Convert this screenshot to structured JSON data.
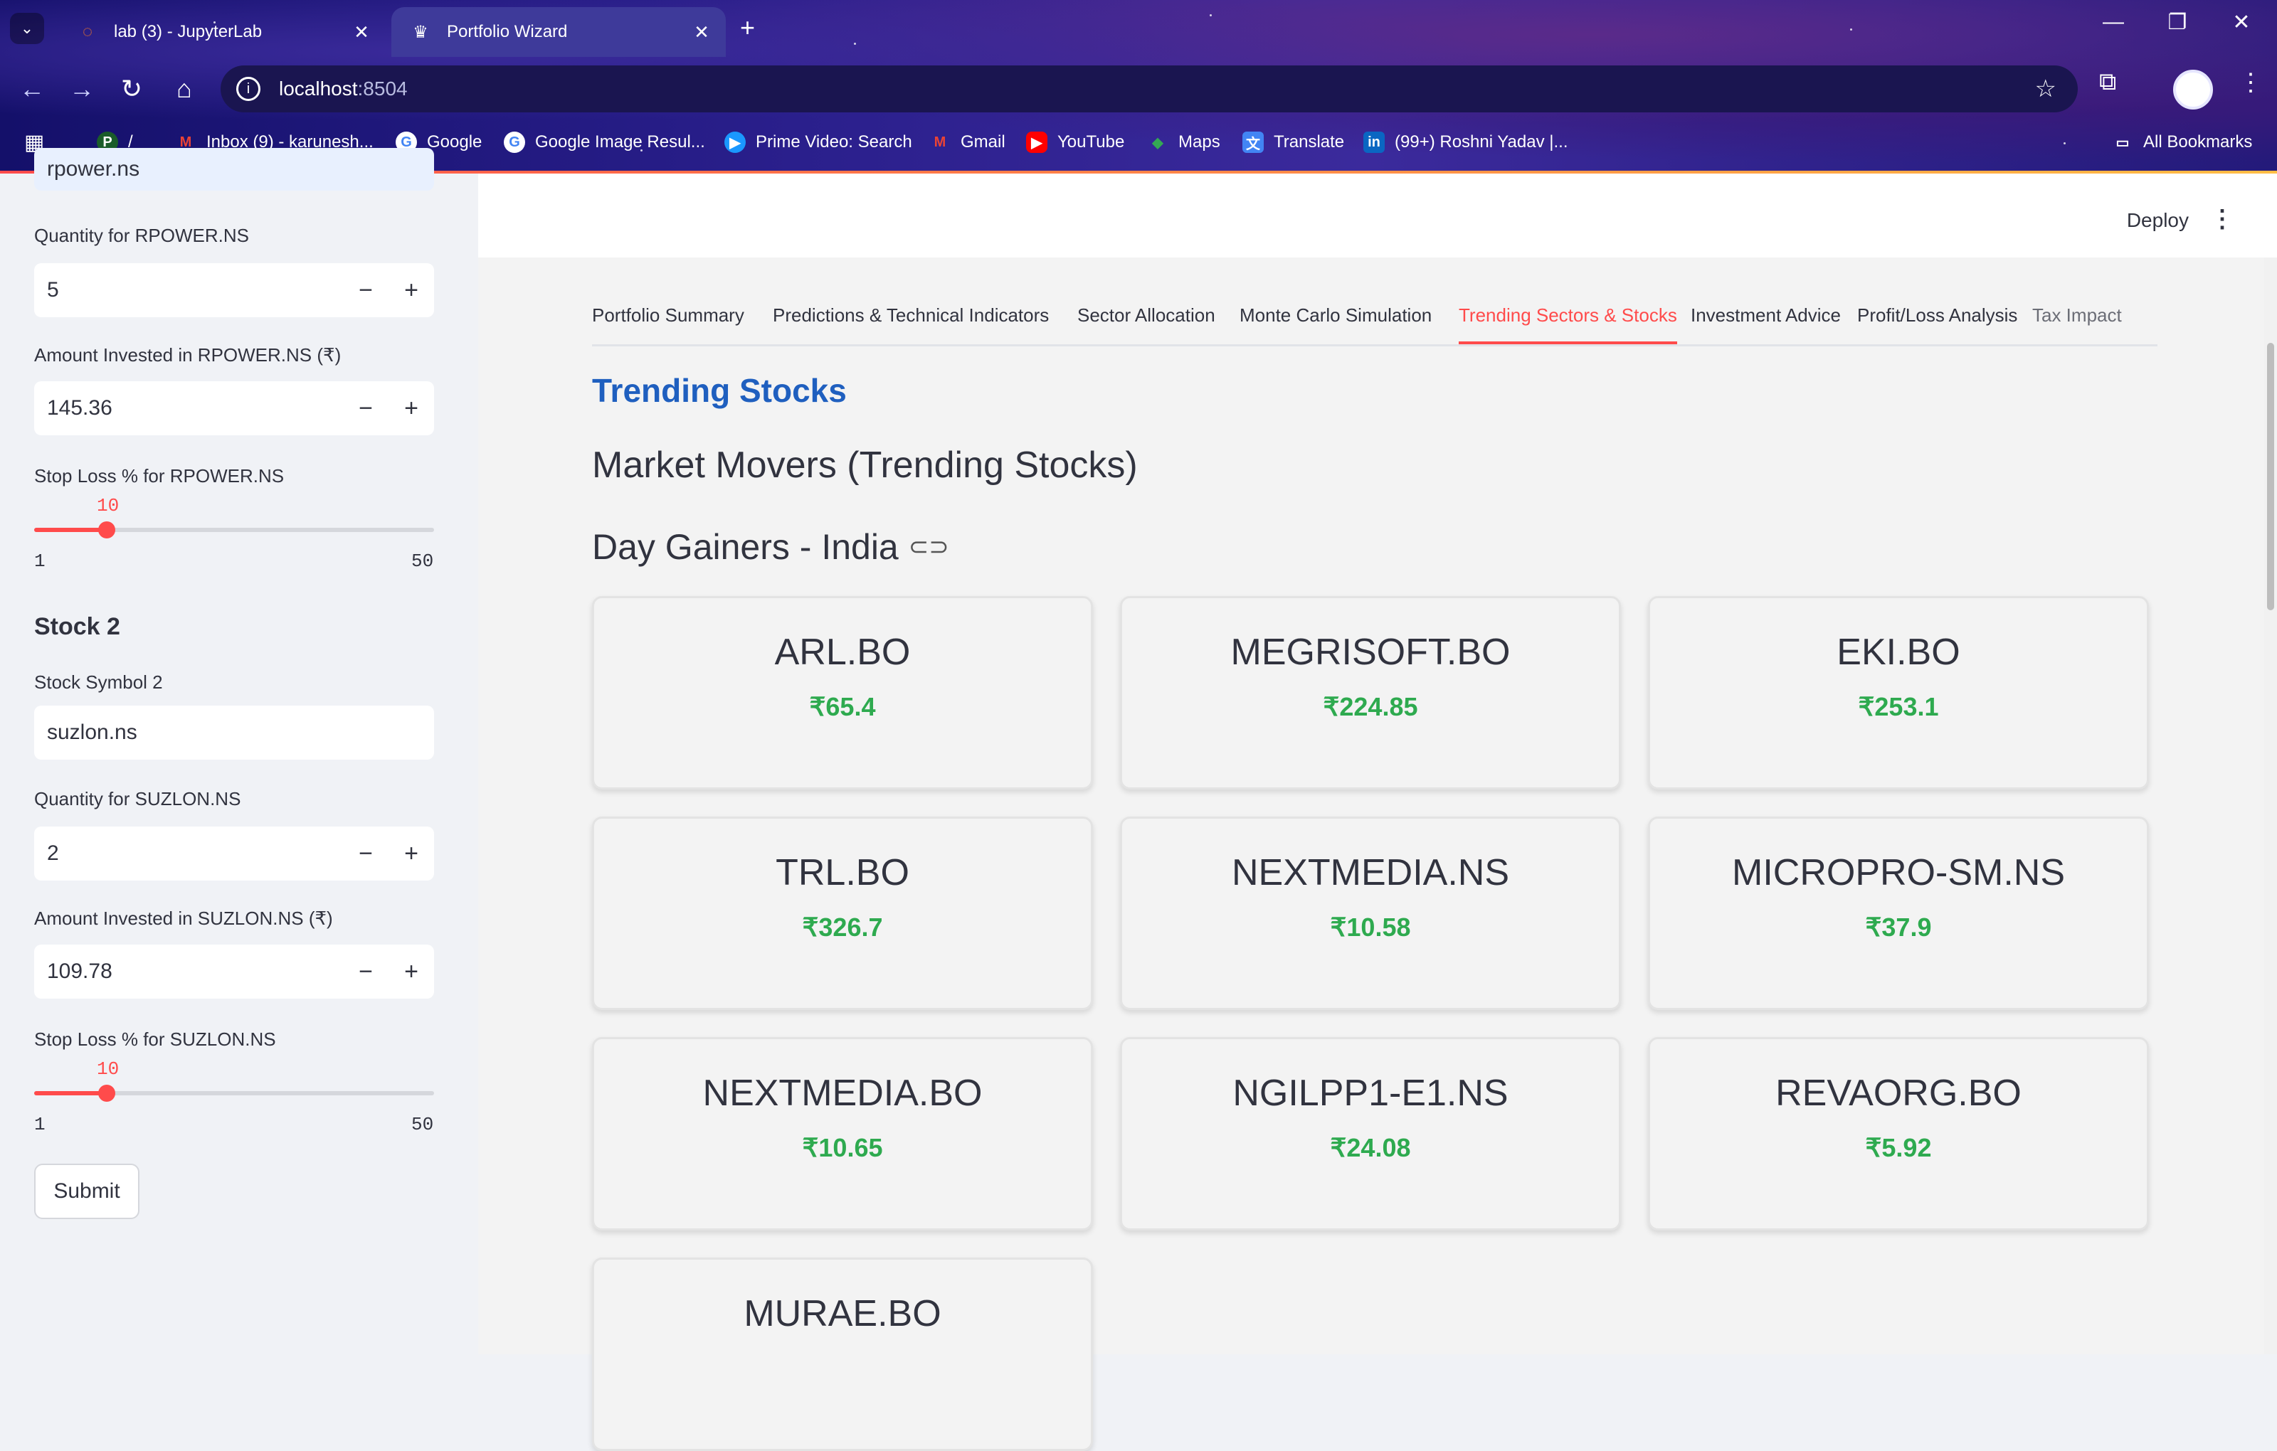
{
  "browser": {
    "tabs": [
      {
        "title": "lab (3) - JupyterLab",
        "active": false
      },
      {
        "title": "Portfolio Wizard",
        "active": true
      }
    ],
    "url_host": "localhost",
    "url_port": ":8504",
    "bookmarks": [
      "/",
      "Inbox (9) - karunesh...",
      "Google",
      "Google Image Resul...",
      "Prime Video: Search",
      "Gmail",
      "YouTube",
      "Maps",
      "Translate",
      "(99+) Roshni Yadav |...",
      "All Bookmarks"
    ]
  },
  "header": {
    "deploy": "Deploy"
  },
  "sidebar": {
    "partial_input": "rpower.ns",
    "stock1": {
      "qty_label": "Quantity for RPOWER.NS",
      "qty_value": "5",
      "amount_label": "Amount Invested in RPOWER.NS (₹)",
      "amount_value": "145.36",
      "stoploss_label": "Stop Loss % for RPOWER.NS",
      "stoploss_value": "10",
      "stoploss_min": "1",
      "stoploss_max": "50"
    },
    "stock2_heading": "Stock 2",
    "stock2": {
      "symbol_label": "Stock Symbol 2",
      "symbol_value": "suzlon.ns",
      "qty_label": "Quantity for SUZLON.NS",
      "qty_value": "2",
      "amount_label": "Amount Invested in SUZLON.NS (₹)",
      "amount_value": "109.78",
      "stoploss_label": "Stop Loss % for SUZLON.NS",
      "stoploss_value": "10",
      "stoploss_min": "1",
      "stoploss_max": "50"
    },
    "submit": "Submit"
  },
  "main": {
    "tabs": [
      "Portfolio Summary",
      "Predictions & Technical Indicators",
      "Sector Allocation",
      "Monte Carlo Simulation",
      "Trending Sectors & Stocks",
      "Investment Advice",
      "Profit/Loss Analysis",
      "Tax Impact"
    ],
    "selected_tab": "Trending Sectors & Stocks",
    "heading_trending": "Trending Stocks",
    "heading_market": "Market Movers (Trending Stocks)",
    "heading_gainers": "Day Gainers - India",
    "cards": [
      {
        "symbol": "ARL.BO",
        "price": "₹65.4"
      },
      {
        "symbol": "MEGRISOFT.BO",
        "price": "₹224.85"
      },
      {
        "symbol": "EKI.BO",
        "price": "₹253.1"
      },
      {
        "symbol": "TRL.BO",
        "price": "₹326.7"
      },
      {
        "symbol": "NEXTMEDIA.NS",
        "price": "₹10.58"
      },
      {
        "symbol": "MICROPRO-SM.NS",
        "price": "₹37.9"
      },
      {
        "symbol": "NEXTMEDIA.BO",
        "price": "₹10.65"
      },
      {
        "symbol": "NGILPP1-E1.NS",
        "price": "₹24.08"
      },
      {
        "symbol": "REVAORG.BO",
        "price": "₹5.92"
      },
      {
        "symbol": "MURAE.BO",
        "price": ""
      }
    ]
  },
  "colors": {
    "accent": "#ff4b4b",
    "heading_blue": "#1f5fbf",
    "price_green": "#2eaa4f"
  }
}
